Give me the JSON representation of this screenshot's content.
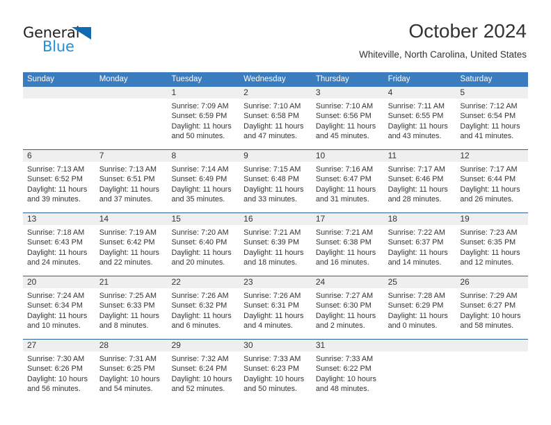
{
  "brand": {
    "name_part1": "General",
    "name_part2": "Blue",
    "triangle_color": "#1169b0",
    "blue_text_color": "#1f8fd8",
    "dark_text_color": "#231f20"
  },
  "header": {
    "title": "October 2024",
    "subtitle": "Whiteville, North Carolina, United States"
  },
  "calendar": {
    "header_bg": "#3a7cbe",
    "row_divider": "#2b6196",
    "daynum_band_bg": "#efefef",
    "weekdays": [
      "Sunday",
      "Monday",
      "Tuesday",
      "Wednesday",
      "Thursday",
      "Friday",
      "Saturday"
    ],
    "weeks": [
      [
        {
          "day": "",
          "sunrise": "",
          "sunset": "",
          "daylight_line1": "",
          "daylight_line2": ""
        },
        {
          "day": "",
          "sunrise": "",
          "sunset": "",
          "daylight_line1": "",
          "daylight_line2": ""
        },
        {
          "day": "1",
          "sunrise": "Sunrise: 7:09 AM",
          "sunset": "Sunset: 6:59 PM",
          "daylight_line1": "Daylight: 11 hours",
          "daylight_line2": "and 50 minutes."
        },
        {
          "day": "2",
          "sunrise": "Sunrise: 7:10 AM",
          "sunset": "Sunset: 6:58 PM",
          "daylight_line1": "Daylight: 11 hours",
          "daylight_line2": "and 47 minutes."
        },
        {
          "day": "3",
          "sunrise": "Sunrise: 7:10 AM",
          "sunset": "Sunset: 6:56 PM",
          "daylight_line1": "Daylight: 11 hours",
          "daylight_line2": "and 45 minutes."
        },
        {
          "day": "4",
          "sunrise": "Sunrise: 7:11 AM",
          "sunset": "Sunset: 6:55 PM",
          "daylight_line1": "Daylight: 11 hours",
          "daylight_line2": "and 43 minutes."
        },
        {
          "day": "5",
          "sunrise": "Sunrise: 7:12 AM",
          "sunset": "Sunset: 6:54 PM",
          "daylight_line1": "Daylight: 11 hours",
          "daylight_line2": "and 41 minutes."
        }
      ],
      [
        {
          "day": "6",
          "sunrise": "Sunrise: 7:13 AM",
          "sunset": "Sunset: 6:52 PM",
          "daylight_line1": "Daylight: 11 hours",
          "daylight_line2": "and 39 minutes."
        },
        {
          "day": "7",
          "sunrise": "Sunrise: 7:13 AM",
          "sunset": "Sunset: 6:51 PM",
          "daylight_line1": "Daylight: 11 hours",
          "daylight_line2": "and 37 minutes."
        },
        {
          "day": "8",
          "sunrise": "Sunrise: 7:14 AM",
          "sunset": "Sunset: 6:49 PM",
          "daylight_line1": "Daylight: 11 hours",
          "daylight_line2": "and 35 minutes."
        },
        {
          "day": "9",
          "sunrise": "Sunrise: 7:15 AM",
          "sunset": "Sunset: 6:48 PM",
          "daylight_line1": "Daylight: 11 hours",
          "daylight_line2": "and 33 minutes."
        },
        {
          "day": "10",
          "sunrise": "Sunrise: 7:16 AM",
          "sunset": "Sunset: 6:47 PM",
          "daylight_line1": "Daylight: 11 hours",
          "daylight_line2": "and 31 minutes."
        },
        {
          "day": "11",
          "sunrise": "Sunrise: 7:17 AM",
          "sunset": "Sunset: 6:46 PM",
          "daylight_line1": "Daylight: 11 hours",
          "daylight_line2": "and 28 minutes."
        },
        {
          "day": "12",
          "sunrise": "Sunrise: 7:17 AM",
          "sunset": "Sunset: 6:44 PM",
          "daylight_line1": "Daylight: 11 hours",
          "daylight_line2": "and 26 minutes."
        }
      ],
      [
        {
          "day": "13",
          "sunrise": "Sunrise: 7:18 AM",
          "sunset": "Sunset: 6:43 PM",
          "daylight_line1": "Daylight: 11 hours",
          "daylight_line2": "and 24 minutes."
        },
        {
          "day": "14",
          "sunrise": "Sunrise: 7:19 AM",
          "sunset": "Sunset: 6:42 PM",
          "daylight_line1": "Daylight: 11 hours",
          "daylight_line2": "and 22 minutes."
        },
        {
          "day": "15",
          "sunrise": "Sunrise: 7:20 AM",
          "sunset": "Sunset: 6:40 PM",
          "daylight_line1": "Daylight: 11 hours",
          "daylight_line2": "and 20 minutes."
        },
        {
          "day": "16",
          "sunrise": "Sunrise: 7:21 AM",
          "sunset": "Sunset: 6:39 PM",
          "daylight_line1": "Daylight: 11 hours",
          "daylight_line2": "and 18 minutes."
        },
        {
          "day": "17",
          "sunrise": "Sunrise: 7:21 AM",
          "sunset": "Sunset: 6:38 PM",
          "daylight_line1": "Daylight: 11 hours",
          "daylight_line2": "and 16 minutes."
        },
        {
          "day": "18",
          "sunrise": "Sunrise: 7:22 AM",
          "sunset": "Sunset: 6:37 PM",
          "daylight_line1": "Daylight: 11 hours",
          "daylight_line2": "and 14 minutes."
        },
        {
          "day": "19",
          "sunrise": "Sunrise: 7:23 AM",
          "sunset": "Sunset: 6:35 PM",
          "daylight_line1": "Daylight: 11 hours",
          "daylight_line2": "and 12 minutes."
        }
      ],
      [
        {
          "day": "20",
          "sunrise": "Sunrise: 7:24 AM",
          "sunset": "Sunset: 6:34 PM",
          "daylight_line1": "Daylight: 11 hours",
          "daylight_line2": "and 10 minutes."
        },
        {
          "day": "21",
          "sunrise": "Sunrise: 7:25 AM",
          "sunset": "Sunset: 6:33 PM",
          "daylight_line1": "Daylight: 11 hours",
          "daylight_line2": "and 8 minutes."
        },
        {
          "day": "22",
          "sunrise": "Sunrise: 7:26 AM",
          "sunset": "Sunset: 6:32 PM",
          "daylight_line1": "Daylight: 11 hours",
          "daylight_line2": "and 6 minutes."
        },
        {
          "day": "23",
          "sunrise": "Sunrise: 7:26 AM",
          "sunset": "Sunset: 6:31 PM",
          "daylight_line1": "Daylight: 11 hours",
          "daylight_line2": "and 4 minutes."
        },
        {
          "day": "24",
          "sunrise": "Sunrise: 7:27 AM",
          "sunset": "Sunset: 6:30 PM",
          "daylight_line1": "Daylight: 11 hours",
          "daylight_line2": "and 2 minutes."
        },
        {
          "day": "25",
          "sunrise": "Sunrise: 7:28 AM",
          "sunset": "Sunset: 6:29 PM",
          "daylight_line1": "Daylight: 11 hours",
          "daylight_line2": "and 0 minutes."
        },
        {
          "day": "26",
          "sunrise": "Sunrise: 7:29 AM",
          "sunset": "Sunset: 6:27 PM",
          "daylight_line1": "Daylight: 10 hours",
          "daylight_line2": "and 58 minutes."
        }
      ],
      [
        {
          "day": "27",
          "sunrise": "Sunrise: 7:30 AM",
          "sunset": "Sunset: 6:26 PM",
          "daylight_line1": "Daylight: 10 hours",
          "daylight_line2": "and 56 minutes."
        },
        {
          "day": "28",
          "sunrise": "Sunrise: 7:31 AM",
          "sunset": "Sunset: 6:25 PM",
          "daylight_line1": "Daylight: 10 hours",
          "daylight_line2": "and 54 minutes."
        },
        {
          "day": "29",
          "sunrise": "Sunrise: 7:32 AM",
          "sunset": "Sunset: 6:24 PM",
          "daylight_line1": "Daylight: 10 hours",
          "daylight_line2": "and 52 minutes."
        },
        {
          "day": "30",
          "sunrise": "Sunrise: 7:33 AM",
          "sunset": "Sunset: 6:23 PM",
          "daylight_line1": "Daylight: 10 hours",
          "daylight_line2": "and 50 minutes."
        },
        {
          "day": "31",
          "sunrise": "Sunrise: 7:33 AM",
          "sunset": "Sunset: 6:22 PM",
          "daylight_line1": "Daylight: 10 hours",
          "daylight_line2": "and 48 minutes."
        },
        {
          "day": "",
          "sunrise": "",
          "sunset": "",
          "daylight_line1": "",
          "daylight_line2": ""
        },
        {
          "day": "",
          "sunrise": "",
          "sunset": "",
          "daylight_line1": "",
          "daylight_line2": ""
        }
      ]
    ]
  }
}
